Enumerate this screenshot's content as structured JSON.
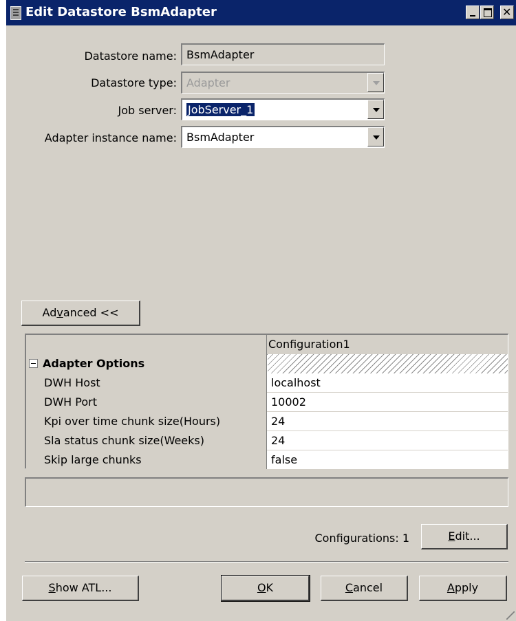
{
  "window": {
    "title": "Edit Datastore BsmAdapter",
    "icon": "datastore-icon",
    "controls": [
      "minimize-icon",
      "maximize-icon",
      "close-icon"
    ]
  },
  "form": {
    "datastore_name_label": "Datastore name:",
    "datastore_name_value": "BsmAdapter",
    "datastore_type_label": "Datastore type:",
    "datastore_type_value": "Adapter",
    "job_server_label": "Job server:",
    "job_server_value": "JobServer_1",
    "adapter_instance_label": "Adapter instance name:",
    "adapter_instance_value": "BsmAdapter"
  },
  "advanced_button": {
    "prefix": "Ad",
    "accel": "v",
    "suffix": "anced <<"
  },
  "grid": {
    "column_header": "Configuration1",
    "group_label": "Adapter Options",
    "rows": [
      {
        "key": "DWH Host",
        "value": "localhost"
      },
      {
        "key": "DWH Port",
        "value": "10002"
      },
      {
        "key": "Kpi over time chunk size(Hours)",
        "value": "24"
      },
      {
        "key": "Sla status chunk size(Weeks)",
        "value": "24"
      },
      {
        "key": "Skip large chunks",
        "value": "false"
      }
    ]
  },
  "configurations": {
    "label": "Configurations: 1",
    "edit_accel": "E",
    "edit_rest": "dit..."
  },
  "buttons": {
    "show_atl_accel": "S",
    "show_atl_rest": "how ATL...",
    "ok_accel": "O",
    "ok_rest": "K",
    "cancel_accel": "C",
    "cancel_rest": "ancel",
    "apply_accel": "A",
    "apply_rest": "pply"
  },
  "colors": {
    "titlebar": "#0a246a",
    "dialog_bg": "#d4d0c8",
    "selection": "#0a246a"
  }
}
